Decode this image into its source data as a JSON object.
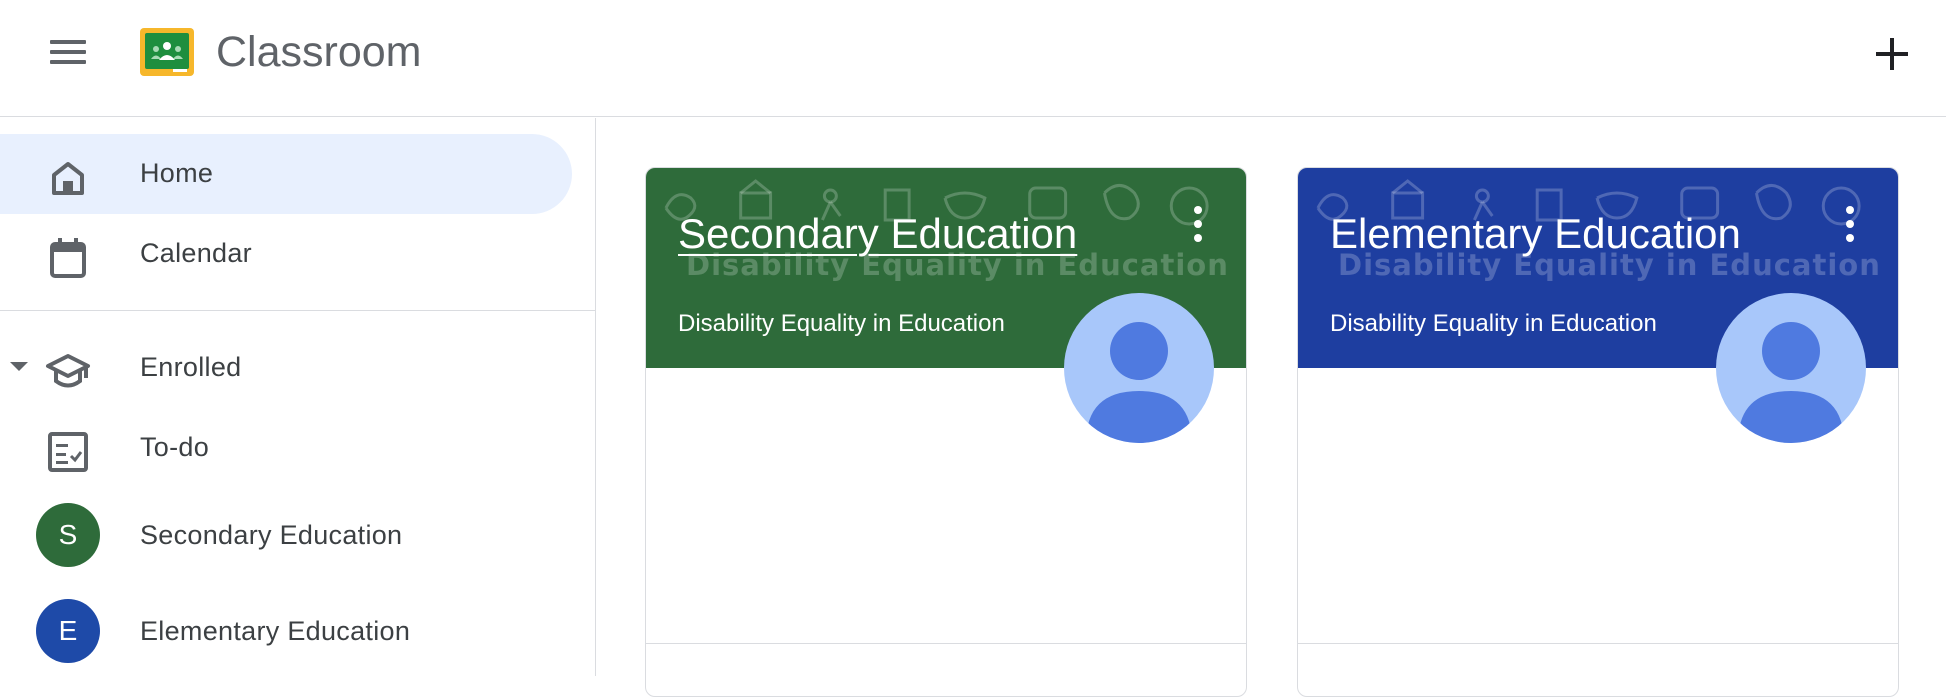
{
  "header": {
    "app_title": "Classroom",
    "menu_icon": "hamburger-menu-icon",
    "logo_icon": "classroom-logo-icon",
    "add_icon": "plus-icon"
  },
  "sidebar": {
    "items": [
      {
        "label": "Home",
        "icon": "home-icon",
        "active": true
      },
      {
        "label": "Calendar",
        "icon": "calendar-icon",
        "active": false
      },
      {
        "label": "Enrolled",
        "icon": "graduation-cap-icon",
        "expanded": true
      },
      {
        "label": "To-do",
        "icon": "todo-checklist-icon"
      },
      {
        "label": "Secondary Education",
        "avatar_letter": "S",
        "color": "#2e6b3a"
      },
      {
        "label": "Elementary Education",
        "avatar_letter": "E",
        "color": "#1e4aa8"
      }
    ]
  },
  "courses": [
    {
      "title": "Secondary Education",
      "section": "Disability Equality in Education",
      "watermark": "Disability Equality in Education",
      "color": "#2e6b3a"
    },
    {
      "title": "Elementary Education",
      "section": "Disability Equality in Education",
      "watermark": "Disability Equality in Education",
      "color": "#1e3ea0"
    }
  ],
  "colors": {
    "active_nav_bg": "#e8f0fe",
    "divider": "#dadce0",
    "avatar_bg": "#a8c7fa",
    "avatar_fg": "#4f7ae0"
  }
}
